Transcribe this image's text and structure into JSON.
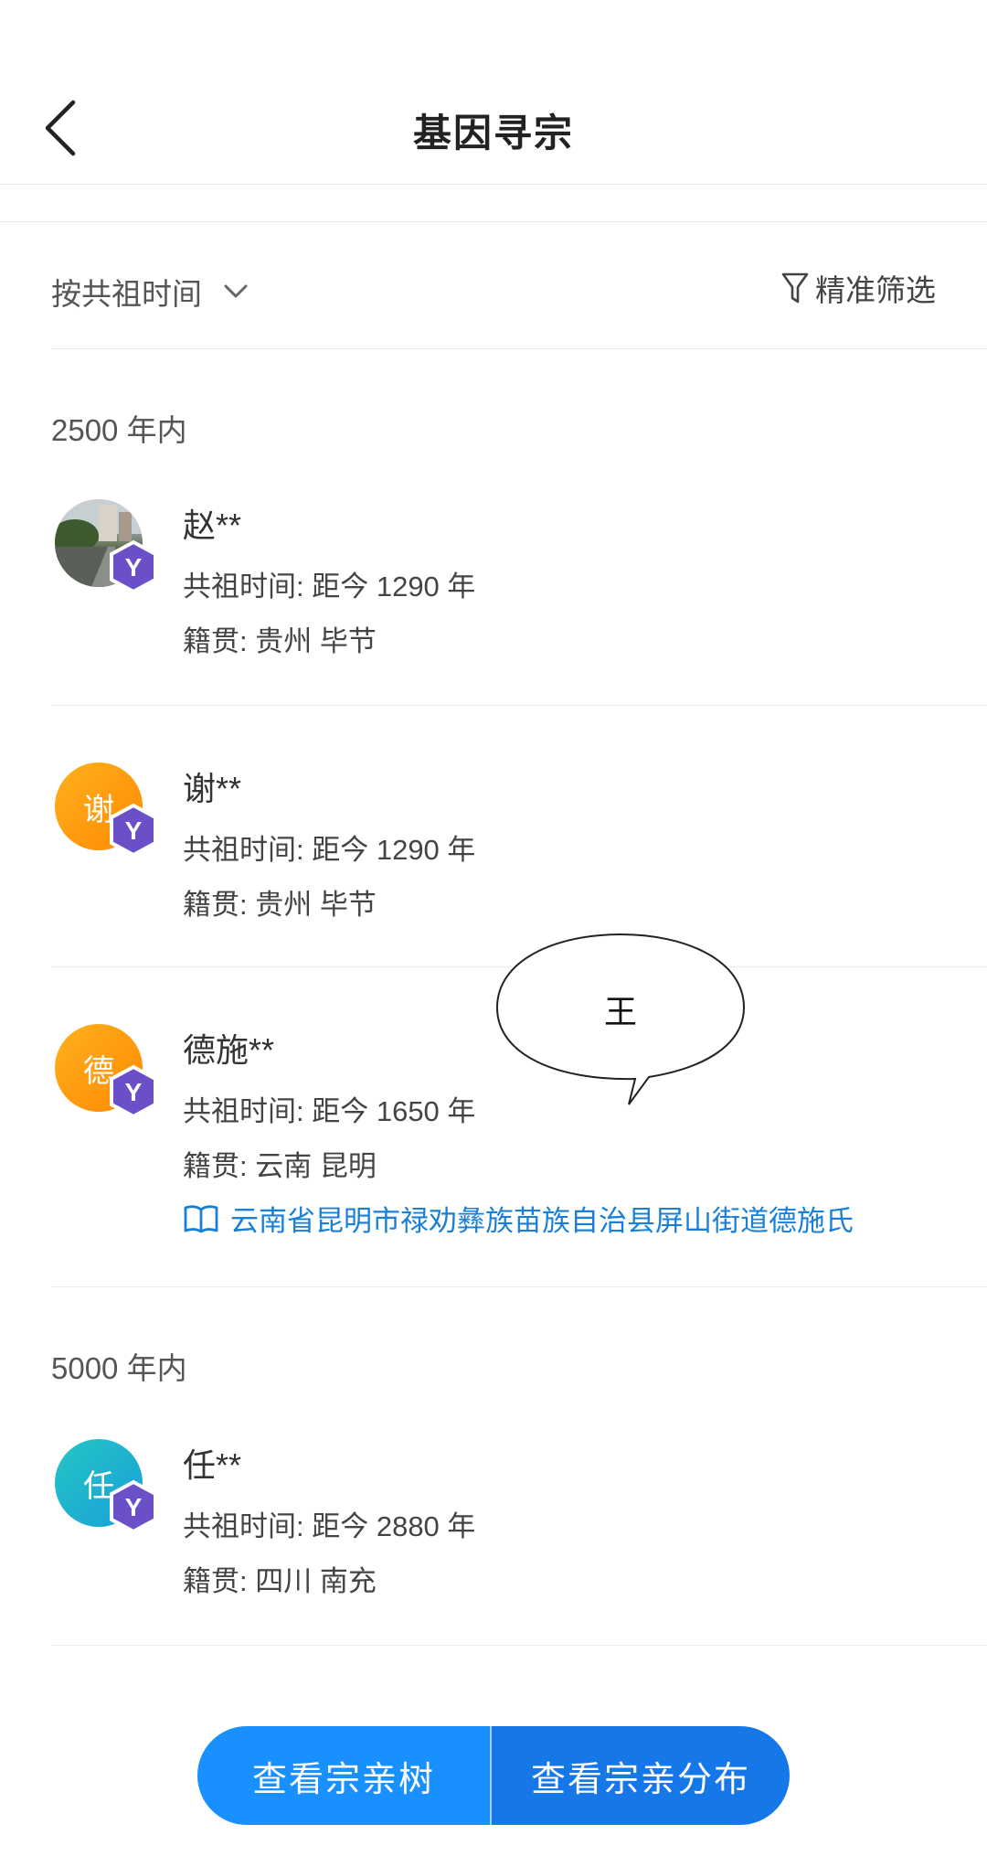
{
  "header": {
    "title": "基因寻宗",
    "back_icon": "chevron-left-icon"
  },
  "filter": {
    "sort_label": "按共祖时间",
    "sort_icon": "chevron-down-icon",
    "filter_label": "精准筛选",
    "filter_icon": "funnel-icon"
  },
  "groups": [
    {
      "label": "2500 年内",
      "items": [
        {
          "name": "赵**",
          "avatar_char": "",
          "avatar_type": "photo",
          "time": "共祖时间: 距今 1290 年",
          "origin": "籍贯: 贵州 毕节"
        },
        {
          "name": "谢**",
          "avatar_char": "谢",
          "avatar_type": "orange",
          "time": "共祖时间: 距今 1290 年",
          "origin": "籍贯: 贵州 毕节"
        },
        {
          "name": "德施**",
          "avatar_char": "德",
          "avatar_type": "orange",
          "time": "共祖时间: 距今 1650 年",
          "origin": "籍贯: 云南 昆明",
          "clan": "云南省昆明市禄劝彝族苗族自治县屏山街道德施氏"
        }
      ]
    },
    {
      "label": "5000 年内",
      "items": [
        {
          "name": "任**",
          "avatar_char": "任",
          "avatar_type": "teal",
          "time": "共祖时间: 距今 2880 年",
          "origin": "籍贯: 四川 南充"
        }
      ]
    }
  ],
  "badge": {
    "letter": "Y",
    "color": "#6a4fc9"
  },
  "bubble": {
    "text": "王"
  },
  "actions": {
    "tree_label": "查看宗亲树",
    "distribution_label": "查看宗亲分布"
  },
  "colors": {
    "primary": "#1890ff",
    "link": "#1a7fd6",
    "avatar_orange": "#ff9a0e",
    "avatar_teal": "#1fb3cf"
  }
}
